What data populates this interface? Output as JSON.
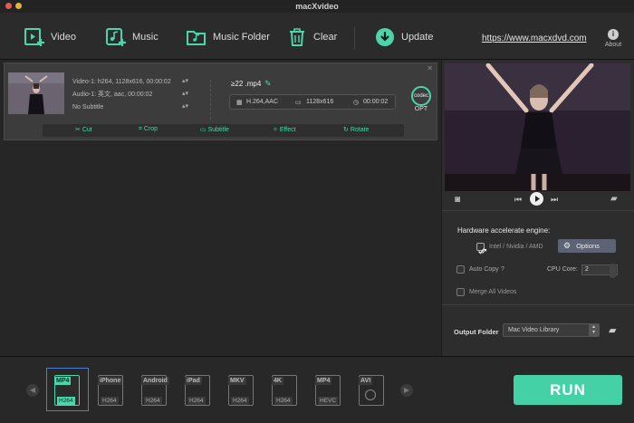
{
  "window": {
    "title": "macXvideo"
  },
  "toolbar": {
    "video_label": "Video",
    "music_label": "Music",
    "music_folder_label": "Music Folder",
    "clear_label": "Clear",
    "update_label": "Update",
    "site_link": "https://www.macxdvd.com",
    "about_label": "About"
  },
  "file": {
    "video_info": "Video-1: h264, 1128x616, 00:00:02",
    "audio_info": "Audio-1: 英文, aac, 00:00:02",
    "subtitle_info": "No Subtitle",
    "output_name": "≥22 .mp4",
    "codec": "H.264,AAC",
    "resolution": "1128x616",
    "duration": "00:00:02",
    "codec_opt_label": "OPT",
    "codec_badge": "codec"
  },
  "edit_bar": {
    "cut": "Cut",
    "crop": "Crop",
    "subtitle": "Subtitle",
    "effect": "Effect",
    "rotate": "Rotate"
  },
  "settings": {
    "hw_title": "Hardware accelerate engine:",
    "hw_option": "Intel / Nvidia / AMD",
    "options_button": "Options",
    "auto_copy": "Auto Copy",
    "auto_copy_help": "?",
    "cpu_core_label": "CPU Core:",
    "cpu_core_value": "2",
    "merge_label": "Merge All Videos",
    "output_folder_label": "Output Folder",
    "output_folder_value": "Mac Video Library"
  },
  "formats": [
    {
      "top": "MP4",
      "bottom": "H264",
      "active": true
    },
    {
      "top": "iPhone",
      "bottom": "H264"
    },
    {
      "top": "Android",
      "bottom": "H264"
    },
    {
      "top": "iPad",
      "bottom": "H264"
    },
    {
      "top": "MKV",
      "bottom": "H264"
    },
    {
      "top": "4K",
      "bottom": "H264"
    },
    {
      "top": "MP4",
      "bottom": "HEVC"
    },
    {
      "top": "AVI",
      "bottom": ""
    }
  ],
  "run_label": "RUN",
  "colors": {
    "accent": "#44d1a5",
    "selection": "#4a7fd0",
    "options_button": "#5d6275"
  }
}
